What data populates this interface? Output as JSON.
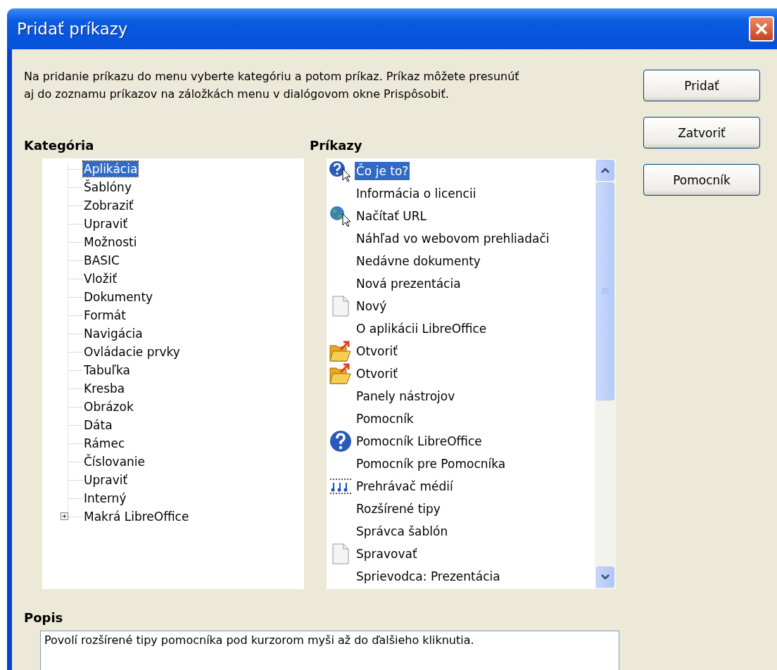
{
  "window": {
    "title": "Pridať príkazy"
  },
  "intro_lines": [
    "Na pridanie príkazu do menu vyberte kategóriu a potom príkaz. Príkaz môžete presunúť",
    "aj do zoznamu príkazov na záložkách menu v dialógovom okne Prispôsobiť."
  ],
  "buttons": [
    {
      "label": "Pridať"
    },
    {
      "label": "Zatvoriť"
    },
    {
      "label": "Pomocník"
    }
  ],
  "category": {
    "heading": "Kategória",
    "items": [
      {
        "label": "Aplikácia",
        "selected": true
      },
      {
        "label": "Šablóny",
        "selected": false
      },
      {
        "label": "Zobraziť",
        "selected": false
      },
      {
        "label": "Upraviť",
        "selected": false
      },
      {
        "label": "Možnosti",
        "selected": false
      },
      {
        "label": "BASIC",
        "selected": false
      },
      {
        "label": "Vložiť",
        "selected": false
      },
      {
        "label": "Dokumenty",
        "selected": false
      },
      {
        "label": "Formát",
        "selected": false
      },
      {
        "label": "Navigácia",
        "selected": false
      },
      {
        "label": "Ovládacie prvky",
        "selected": false
      },
      {
        "label": "Tabuľka",
        "selected": false
      },
      {
        "label": "Kresba",
        "selected": false
      },
      {
        "label": "Obrázok",
        "selected": false
      },
      {
        "label": "Dáta",
        "selected": false
      },
      {
        "label": "Rámec",
        "selected": false
      },
      {
        "label": "Číslovanie",
        "selected": false
      },
      {
        "label": "Upraviť",
        "selected": false
      },
      {
        "label": "Interný",
        "selected": false
      },
      {
        "label": "Makrá LibreOffice",
        "selected": false,
        "expanded": false
      }
    ]
  },
  "commands": {
    "heading": "Príkazy",
    "items": [
      {
        "label": "Čo je to?",
        "selected": true,
        "kind": "help-pointer"
      },
      {
        "label": "Informácia o licencii",
        "selected": false,
        "kind": "none"
      },
      {
        "label": "Načítať URL",
        "selected": false,
        "kind": "globe-pointer"
      },
      {
        "label": "Náhľad vo webovom prehliadači",
        "selected": false,
        "kind": "none"
      },
      {
        "label": "Nedávne dokumenty",
        "selected": false,
        "kind": "none"
      },
      {
        "label": "Nová prezentácia",
        "selected": false,
        "kind": "none"
      },
      {
        "label": "Nový",
        "selected": false,
        "kind": "page"
      },
      {
        "label": "O aplikácii LibreOffice",
        "selected": false,
        "kind": "none"
      },
      {
        "label": "Otvoriť",
        "selected": false,
        "kind": "folder"
      },
      {
        "label": "Otvoriť",
        "selected": false,
        "kind": "folder"
      },
      {
        "label": "Panely nástrojov",
        "selected": false,
        "kind": "none"
      },
      {
        "label": "Pomocník",
        "selected": false,
        "kind": "none"
      },
      {
        "label": "Pomocník LibreOffice",
        "selected": false,
        "kind": "help"
      },
      {
        "label": "Pomocník pre Pomocníka",
        "selected": false,
        "kind": "none"
      },
      {
        "label": "Prehrávač médií",
        "selected": false,
        "kind": "media"
      },
      {
        "label": "Rozšírené tipy",
        "selected": false,
        "kind": "none"
      },
      {
        "label": "Správca šablón",
        "selected": false,
        "kind": "none"
      },
      {
        "label": "Spravovať",
        "selected": false,
        "kind": "page"
      },
      {
        "label": "Sprievodca: Prezentácia",
        "selected": false,
        "kind": "none"
      }
    ]
  },
  "description": {
    "heading": "Popis",
    "text": "Povolí rozšírené tipy pomocníka pod kurzorom myši až do ďalšieho kliknutia."
  }
}
